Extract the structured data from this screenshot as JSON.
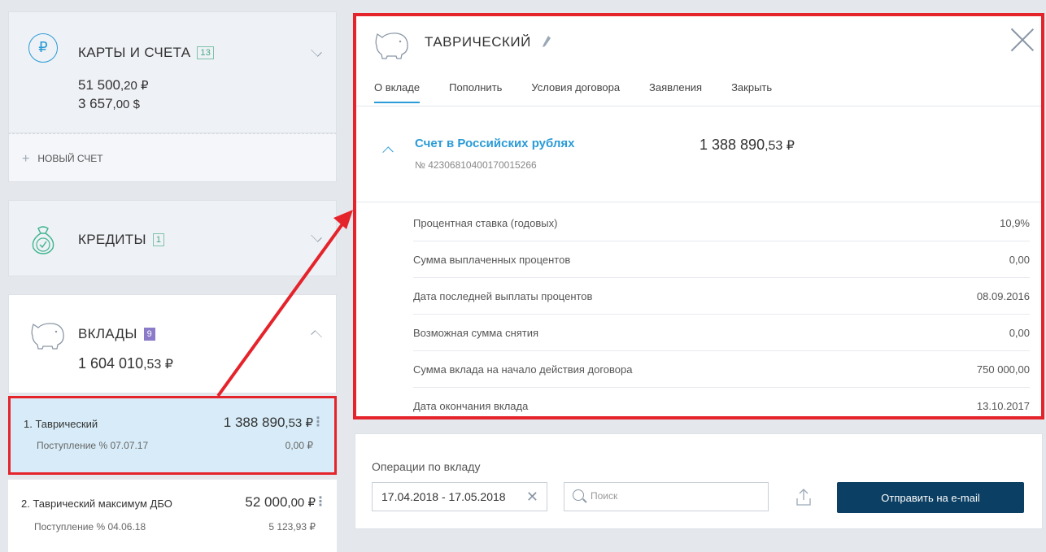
{
  "sidebar": {
    "accounts": {
      "icon": "ruble-icon",
      "icon_glyph": "₽",
      "title": "КАРТЫ И СЧЕТА",
      "count": "13",
      "amount_rub_int": "51 500",
      "amount_rub_frac": ",20 ₽",
      "amount_usd_int": "3 657",
      "amount_usd_frac": ",00 $"
    },
    "new_account_label": "НОВЫЙ СЧЕТ",
    "credits": {
      "icon": "money-bag-icon",
      "title": "КРЕДИТЫ",
      "count": "1"
    },
    "deposits": {
      "icon": "piggy-bank-icon",
      "title": "ВКЛАДЫ",
      "count": "9",
      "total_int": "1 604 010",
      "total_frac": ",53 ₽"
    },
    "deposit_items": [
      {
        "name": "1. Таврический",
        "amount_int": "1 388 890",
        "amount_frac": ",53 ₽",
        "income": "Поступление % 07.07.17",
        "income_amount": "0,00 ₽"
      },
      {
        "name": "2. Таврический максимум ДБО",
        "amount_int": "52 000",
        "amount_frac": ",00 ₽",
        "income": "Поступление % 04.06.18",
        "income_amount": "5 123,93 ₽"
      }
    ]
  },
  "panel": {
    "title": "ТАВРИЧЕСКИЙ",
    "tabs": [
      "О вкладе",
      "Пополнить",
      "Условия договора",
      "Заявления",
      "Закрыть"
    ],
    "active_tab": "О вкладе",
    "account": {
      "title": "Счет в Российских рублях",
      "number": "№ 42306810400170015266",
      "sum_int": "1 388 890",
      "sum_frac": ",53 ₽"
    },
    "details": [
      {
        "label": "Процентная ставка (годовых)",
        "value": "10,9%"
      },
      {
        "label": "Сумма выплаченных процентов",
        "value": "0,00"
      },
      {
        "label": "Дата последней выплаты процентов",
        "value": "08.09.2016"
      },
      {
        "label": "Возможная сумма снятия",
        "value": "0,00"
      },
      {
        "label": "Сумма вклада на начало действия договора",
        "value": "750 000,00"
      },
      {
        "label": "Дата окончания вклада",
        "value": "13.10.2017"
      }
    ]
  },
  "operations": {
    "title": "Операции по вкладу",
    "date_range": "17.04.2018 - 17.05.2018",
    "search_placeholder": "Поиск",
    "send_button": "Отправить на e-mail"
  },
  "colors": {
    "accent": "#2a9bd6",
    "highlight": "#e5232b",
    "button": "#0b3f63",
    "selected_bg": "#d7ecf8"
  }
}
